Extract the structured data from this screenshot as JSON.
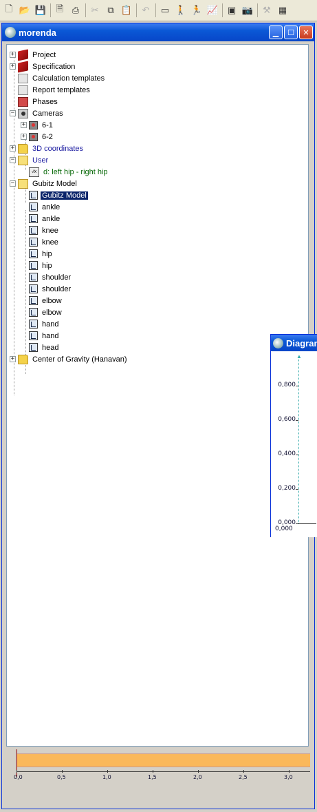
{
  "toolbar": {
    "icons": [
      "new-icon",
      "open-icon",
      "save-icon",
      "print-preview-icon",
      "print-icon",
      "cut-icon",
      "copy-icon",
      "paste-icon",
      "undo-icon",
      "window-icon",
      "figure-icon",
      "figure-run-icon",
      "chart-icon",
      "display-icon",
      "camera-icon",
      "tool-icon",
      "calculator-icon"
    ]
  },
  "window": {
    "title": "morenda"
  },
  "tree": {
    "items": [
      {
        "label": "Project"
      },
      {
        "label": "Specification"
      },
      {
        "label": "Calculation templates"
      },
      {
        "label": "Report templates"
      },
      {
        "label": "Phases"
      },
      {
        "label": "Cameras"
      },
      {
        "label": "6-1"
      },
      {
        "label": "6-2"
      },
      {
        "label": "3D coordinates"
      },
      {
        "label": "User"
      },
      {
        "label": "d: left hip - right hip"
      },
      {
        "label": "Gubitz Model"
      },
      {
        "label": "Gubitz Model"
      },
      {
        "label": "ankle"
      },
      {
        "label": "ankle"
      },
      {
        "label": "knee"
      },
      {
        "label": "knee"
      },
      {
        "label": "hip"
      },
      {
        "label": "hip"
      },
      {
        "label": "shoulder"
      },
      {
        "label": "shoulder"
      },
      {
        "label": "elbow"
      },
      {
        "label": "elbow"
      },
      {
        "label": "hand"
      },
      {
        "label": "hand"
      },
      {
        "label": "head"
      },
      {
        "label": "Center of Gravity (Hanavan)"
      }
    ]
  },
  "timeline": {
    "labels": [
      "0,0",
      "0,5",
      "1,0",
      "1,5",
      "2,0",
      "2,5",
      "3,0"
    ]
  },
  "diagram": {
    "title": "Diagram",
    "y_labels": [
      "0,800",
      "0,600",
      "0,400",
      "0,200",
      "0,000"
    ],
    "x_label": "0,000"
  },
  "colors": {
    "titlebar": "#0a58d6",
    "selection": "#0a246a",
    "timeline_bar": "#fab85a"
  }
}
